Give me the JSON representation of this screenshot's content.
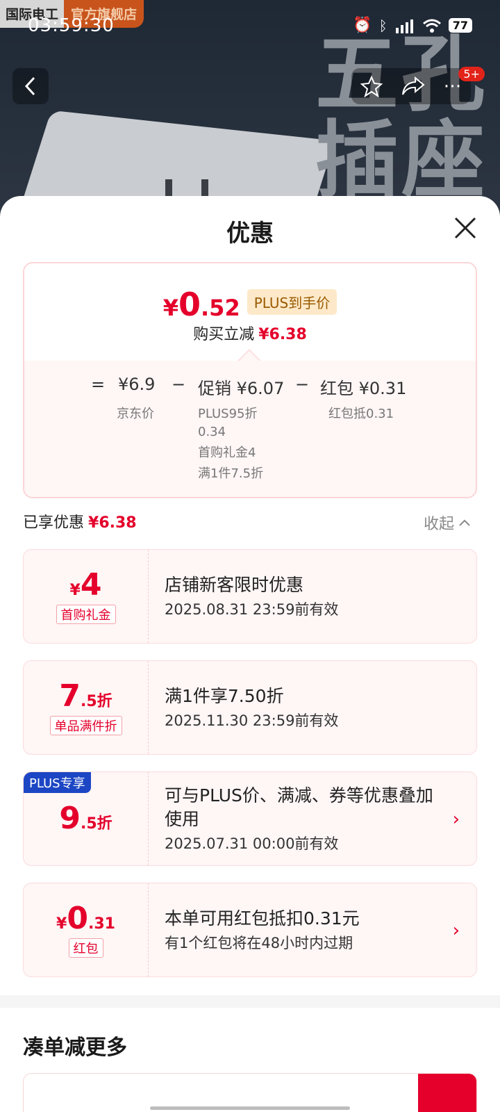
{
  "status_bar": {
    "time": "03:59:30",
    "battery": "77"
  },
  "store": {
    "name": "国际电工",
    "tag": "官方旗舰店"
  },
  "hero": {
    "line1": "五孔",
    "line2": "插座"
  },
  "nav": {
    "badge": "5+"
  },
  "sheet": {
    "title": "优惠",
    "price": {
      "symbol": "¥",
      "int": "0",
      "dec": ".52",
      "tag": "PLUS到手价",
      "reduce_label": "购买立减",
      "reduce_value": "¥6.38"
    },
    "formula": {
      "eq": "=",
      "jd_price": "¥6.9",
      "minus1": "−",
      "promo": "促销 ¥6.07",
      "minus2": "−",
      "redpacket": "红包 ¥0.31",
      "jd_label": "京东价",
      "promo_details": [
        "PLUS95折",
        "0.34",
        "首购礼金4",
        "满1件7.5折"
      ],
      "redpacket_detail": "红包抵0.31"
    },
    "enjoyed": {
      "label": "已享优惠",
      "value": "¥6.38",
      "collapse": "收起"
    },
    "coupons": [
      {
        "sym": "¥",
        "big": "4",
        "minor": "",
        "label": "首购礼金",
        "title": "店铺新客限时优惠",
        "sub": "2025.08.31 23:59前有效"
      },
      {
        "sym": "",
        "big": "7",
        "minor": ".5折",
        "label": "单品满件折",
        "title": "满1件享7.50折",
        "sub": "2025.11.30 23:59前有效"
      },
      {
        "sym": "",
        "big": "9",
        "minor": ".5折",
        "corner": "PLUS专享",
        "title": "可与PLUS价、满减、券等优惠叠加使用",
        "sub": "2025.07.31 00:00前有效"
      },
      {
        "sym": "¥",
        "big": "0",
        "minor": ".31",
        "label": "红包",
        "title": "本单可用红包抵扣0.31元",
        "sub": "有1个红包将在48小时内过期"
      }
    ],
    "more_title": "凑单减更多"
  },
  "colors": {
    "accent": "#e4002b",
    "plus_blue": "#1c46c4"
  }
}
